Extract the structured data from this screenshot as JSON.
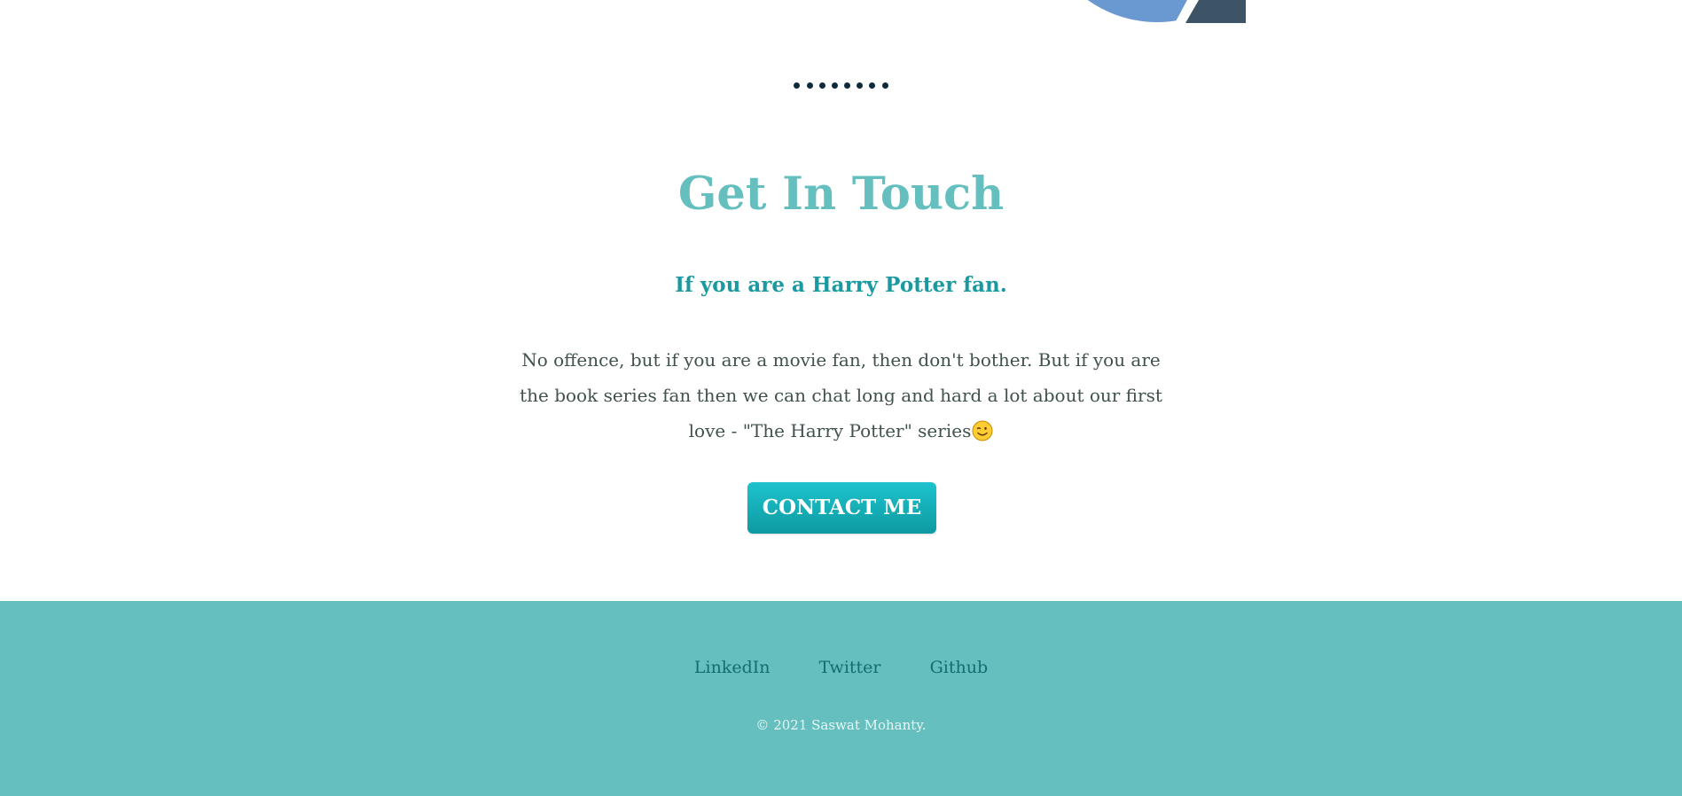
{
  "divider": {
    "dot_count": 8
  },
  "contact": {
    "title": "Get In Touch",
    "subtitle": "If you are a Harry Potter fan.",
    "body": "No offence, but if you are a movie fan, then don't bother. But if you are the book series fan then we can chat long and hard a lot about our first love - \"The Harry Potter\" series",
    "emoji_icon": "winking-face-icon",
    "button_label": "CONTACT ME"
  },
  "footer": {
    "links": [
      {
        "label": "LinkedIn"
      },
      {
        "label": "Twitter"
      },
      {
        "label": "Github"
      }
    ],
    "copyright": "© 2021 Saswat Mohanty."
  },
  "colors": {
    "title": "#66bfbf",
    "subtitle": "#1a9aa0",
    "body_text": "#40514e",
    "button": "#11adb5",
    "footer_background": "#66bfbf",
    "footer_link": "#116d6e",
    "dot": "#0f2a3a"
  }
}
